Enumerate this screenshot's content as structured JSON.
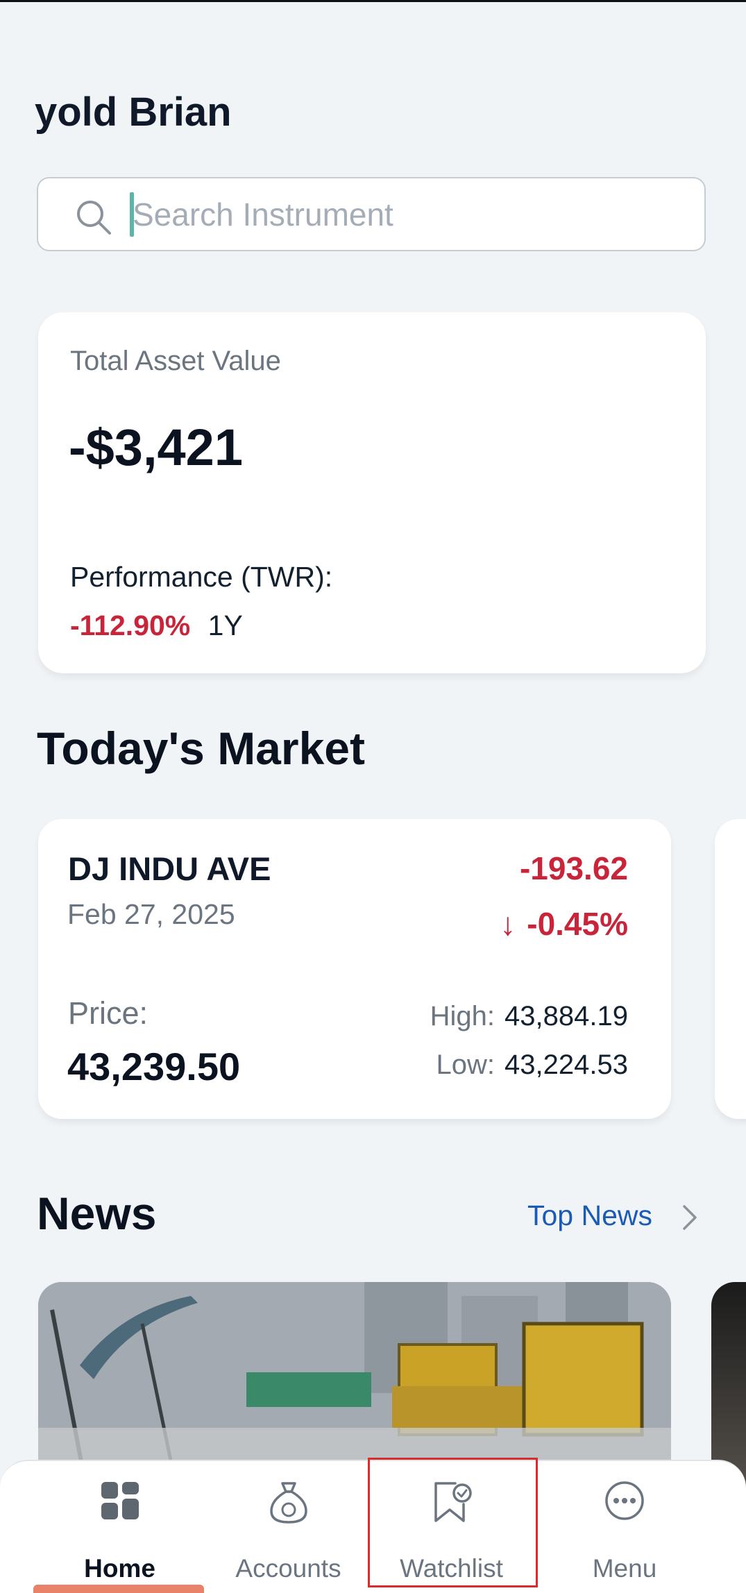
{
  "greeting": "yold Brian",
  "search": {
    "placeholder": "Search Instrument",
    "value": ""
  },
  "asset": {
    "label": "Total Asset Value",
    "value": "-$3,421",
    "performance_label": "Performance (TWR):",
    "performance_value": "-112.90%",
    "performance_period": "1Y"
  },
  "market": {
    "title": "Today's Market",
    "cards": [
      {
        "name": "DJ INDU AVE",
        "date": "Feb 27, 2025",
        "change": "-193.62",
        "change_pct": "-0.45%",
        "direction_glyph": "↓",
        "price_label": "Price:",
        "price": "43,239.50",
        "high_label": "High:",
        "high": "43,884.19",
        "low_label": "Low:",
        "low": "43,224.53"
      }
    ]
  },
  "news": {
    "title": "News",
    "link_label": "Top News"
  },
  "nav": {
    "items": [
      {
        "label": "Home",
        "icon": "grid-icon",
        "active": true
      },
      {
        "label": "Accounts",
        "icon": "money-bag-icon",
        "active": false
      },
      {
        "label": "Watchlist",
        "icon": "bookmark-check-icon",
        "active": false
      },
      {
        "label": "Menu",
        "icon": "more-icon",
        "active": false
      }
    ]
  },
  "colors": {
    "background": "#f1f4f7",
    "negative": "#c8253b",
    "link": "#1b5bb5",
    "accent_indicator": "#e8836a",
    "highlight": "#d92c2c"
  }
}
